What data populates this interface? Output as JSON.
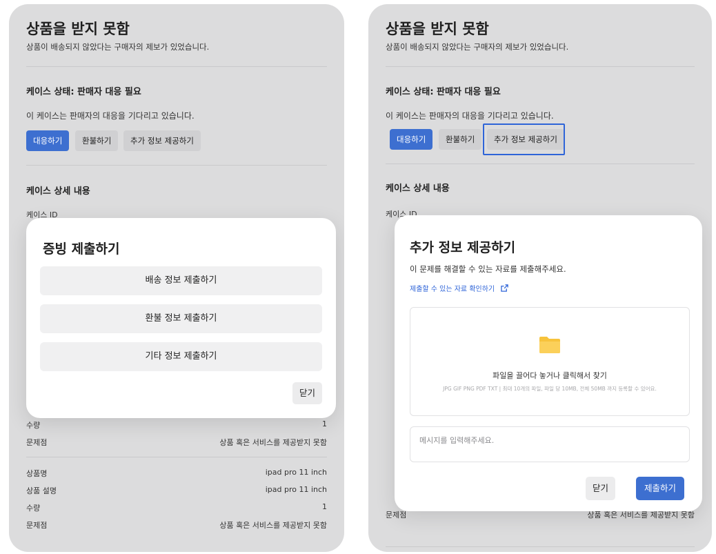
{
  "case": {
    "title": "상품을 받지 못함",
    "subtitle": "상품이 배송되지 않았다는 구매자의 제보가 있었습니다.",
    "status_heading": "케이스 상태: 판매자 대응 필요",
    "status_text": "이 케이스는 판매자의 대응을 기다리고 있습니다.",
    "actions": {
      "respond": "대응하기",
      "refund": "환불하기",
      "more_info": "추가 정보 제공하기"
    },
    "details_heading": "케이스 상세 내용",
    "case_id_label": "케이스 ID",
    "items": [
      {
        "qty_label": "수량",
        "qty_value": "1",
        "issue_label": "문제점",
        "issue_value": "상품 혹은 서비스를 제공받지 못함"
      },
      {
        "name_label": "상품명",
        "name_value": "ipad pro 11 inch",
        "desc_label": "상품 설명",
        "desc_value": "ipad pro 11 inch",
        "qty_label": "수량",
        "qty_value": "1",
        "issue_label": "문제점",
        "issue_value": "상품 혹은 서비스를 제공받지 못함"
      }
    ]
  },
  "evidence_modal": {
    "title": "증빙 제출하기",
    "options": [
      "배송 정보 제출하기",
      "환불 정보 제출하기",
      "기타 정보 제출하기"
    ],
    "close_label": "닫기"
  },
  "info_modal": {
    "title": "추가 정보 제공하기",
    "description": "이 문제를 해결할 수 있는 자료를 제출해주세요.",
    "link": "제출할 수 있는 자료 확인하기",
    "dropzone_main": "파일을 끌어다 놓거나 클릭해서 찾기",
    "dropzone_sub": "JPG GIF PNG PDF TXT | 최대 10개의 파일, 파일 당 10MB, 전체 50MB 까지 등록할 수 있어요.",
    "message_placeholder": "메시지를 입력해주세요.",
    "close_label": "닫기",
    "submit_label": "제출하기"
  },
  "colors": {
    "accent": "#3d6fd0",
    "highlight": "#2e64d8",
    "panel_bg": "#dcdcdd",
    "folder": "#f7c33c"
  },
  "icons": [
    "folder-icon",
    "external-link-icon"
  ]
}
